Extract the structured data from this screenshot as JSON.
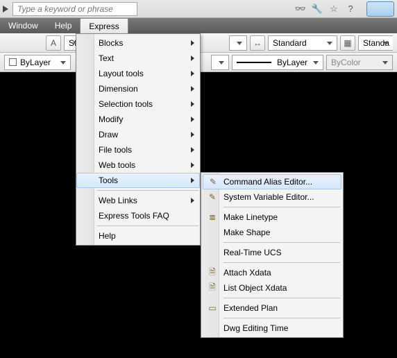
{
  "topbar": {
    "search_placeholder": "Type a keyword or phrase"
  },
  "menubar": {
    "window": "Window",
    "help": "Help",
    "express": "Express"
  },
  "ribbon": {
    "style_abbrev": "Sta",
    "standard": "Standard",
    "standard_abbrev": "Standa",
    "bylayer": "ByLayer",
    "bylayer2": "ByLayer",
    "bycolor": "ByColor"
  },
  "express_menu": {
    "items": [
      {
        "label": "Blocks",
        "sub": true
      },
      {
        "label": "Text",
        "sub": true
      },
      {
        "label": "Layout tools",
        "sub": true
      },
      {
        "label": "Dimension",
        "sub": true
      },
      {
        "label": "Selection tools",
        "sub": true
      },
      {
        "label": "Modify",
        "sub": true
      },
      {
        "label": "Draw",
        "sub": true
      },
      {
        "label": "File tools",
        "sub": true
      },
      {
        "label": "Web tools",
        "sub": true
      },
      {
        "label": "Tools",
        "sub": true,
        "hl": true
      }
    ],
    "group2": [
      {
        "label": "Web Links",
        "sub": true
      },
      {
        "label": "Express Tools FAQ"
      }
    ],
    "group3": [
      {
        "label": "Help"
      }
    ]
  },
  "tools_submenu": {
    "g1": [
      {
        "label": "Command Alias Editor...",
        "glyph": "✎",
        "hl": true
      },
      {
        "label": "System Variable Editor...",
        "glyph": "✎"
      }
    ],
    "g2": [
      {
        "label": "Make Linetype",
        "glyph": "≣"
      },
      {
        "label": "Make Shape"
      }
    ],
    "g3": [
      {
        "label": "Real-Time UCS"
      }
    ],
    "g4": [
      {
        "label": "Attach Xdata",
        "glyph": "🗎"
      },
      {
        "label": "List Object Xdata",
        "glyph": "🗎"
      }
    ],
    "g5": [
      {
        "label": "Extended Plan",
        "glyph": "▭"
      }
    ],
    "g6": [
      {
        "label": "Dwg Editing Time"
      }
    ]
  }
}
